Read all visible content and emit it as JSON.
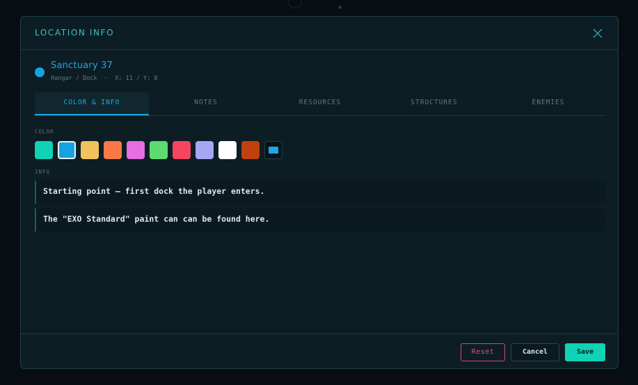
{
  "modal": {
    "title": "LOCATION INFO",
    "close_icon": "close-icon"
  },
  "location": {
    "name": "Sanctuary 37",
    "meta": "Hangar / Dock  ·  X: 11 / Y: 8",
    "dot_color": "#15a4e3"
  },
  "tabs": [
    {
      "label": "COLOR & INFO",
      "active": true
    },
    {
      "label": "NOTES",
      "active": false
    },
    {
      "label": "RESOURCES",
      "active": false
    },
    {
      "label": "STRUCTURES",
      "active": false
    },
    {
      "label": "ENEMIES",
      "active": false
    }
  ],
  "color_section": {
    "label": "COLOR",
    "swatches": [
      {
        "color": "#10d2b5",
        "selected": false
      },
      {
        "color": "#15a4e3",
        "selected": true
      },
      {
        "color": "#f2c25c",
        "selected": false
      },
      {
        "color": "#f97a45",
        "selected": false
      },
      {
        "color": "#e56ee0",
        "selected": false
      },
      {
        "color": "#5cdc6e",
        "selected": false
      },
      {
        "color": "#f4465f",
        "selected": false
      },
      {
        "color": "#a6a6f4",
        "selected": false
      },
      {
        "color": "#ffffff",
        "selected": false
      },
      {
        "color": "#c0410e",
        "selected": false
      }
    ],
    "custom_swatch_color": "#1ea7e4"
  },
  "info_section": {
    "label": "INFO",
    "items": [
      "Starting point — first dock the player enters.",
      "The \"EXO Standard\" paint can can be found here."
    ]
  },
  "footer": {
    "reset_label": "Reset",
    "cancel_label": "Cancel",
    "save_label": "Save"
  },
  "colors": {
    "accent_teal": "#10d2b5",
    "accent_blue": "#1ea7e4",
    "danger": "#e0566b",
    "background": "#0d1d24"
  }
}
